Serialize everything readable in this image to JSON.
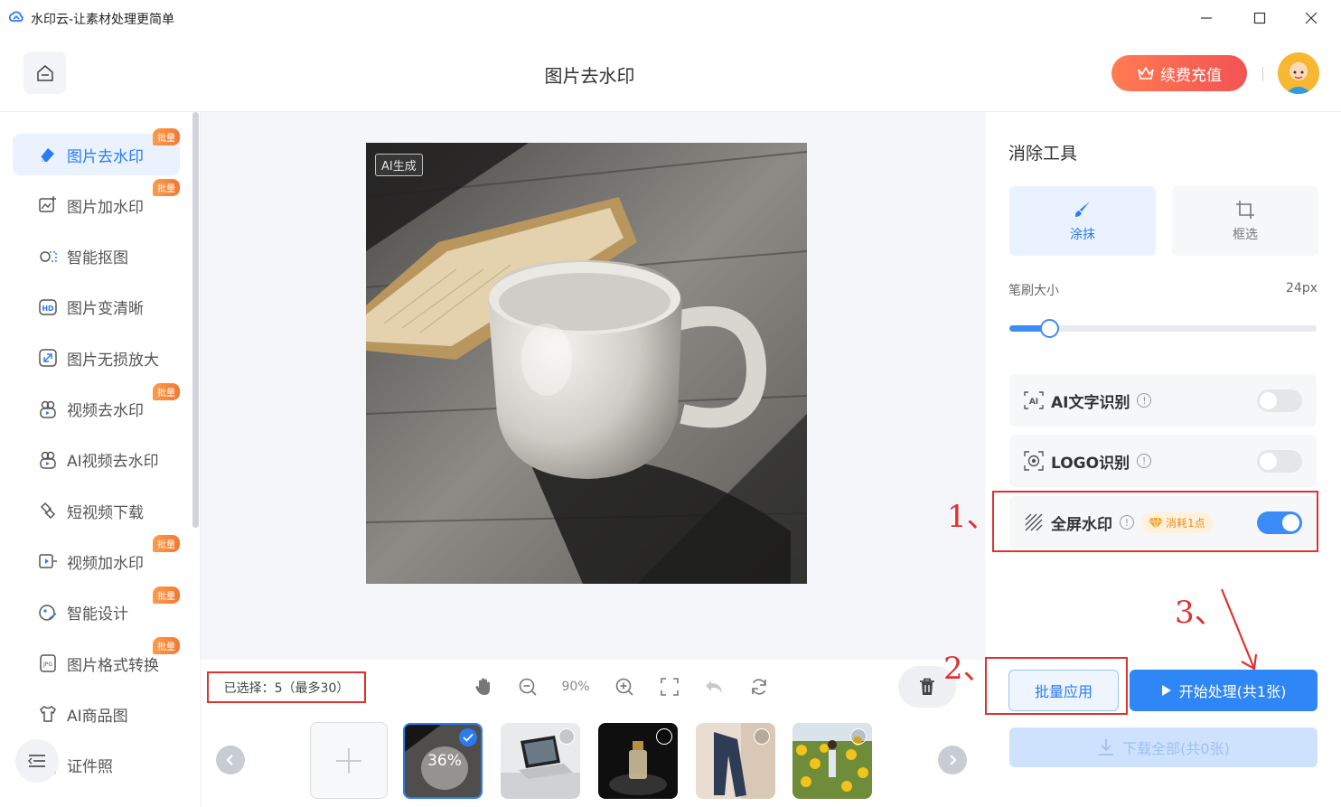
{
  "window": {
    "title": "水印云-让素材处理更简单"
  },
  "header": {
    "page_title": "图片去水印",
    "renew_label": "续费充值"
  },
  "sidebar": {
    "items": [
      {
        "label": "图片去水印",
        "badge": "批量",
        "icon": "eraser-icon",
        "active": true
      },
      {
        "label": "图片加水印",
        "badge": "批量",
        "icon": "image-add-icon"
      },
      {
        "label": "智能抠图",
        "badge": "",
        "icon": "cutout-icon"
      },
      {
        "label": "图片变清晰",
        "badge": "",
        "icon": "hd-icon"
      },
      {
        "label": "图片无损放大",
        "badge": "",
        "icon": "enlarge-icon"
      },
      {
        "label": "视频去水印",
        "badge": "批量",
        "icon": "video-eraser-icon"
      },
      {
        "label": "AI视频去水印",
        "badge": "",
        "icon": "ai-video-eraser-icon"
      },
      {
        "label": "短视频下载",
        "badge": "",
        "icon": "link-download-icon"
      },
      {
        "label": "视频加水印",
        "badge": "批量",
        "icon": "video-add-icon"
      },
      {
        "label": "智能设计",
        "badge": "批量",
        "icon": "design-icon"
      },
      {
        "label": "图片格式转换",
        "badge": "批量",
        "icon": "jpg-file-icon"
      },
      {
        "label": "AI商品图",
        "badge": "",
        "icon": "tshirt-icon"
      },
      {
        "label": "证件照",
        "badge": "",
        "icon": "id-photo-icon"
      }
    ]
  },
  "canvas": {
    "ai_badge": "AI生成"
  },
  "toolbar": {
    "selected_text": "已选择：5（最多30）",
    "zoom": "90%"
  },
  "thumbnails": {
    "progress_label": "36%"
  },
  "panel": {
    "title": "消除工具",
    "modes": [
      {
        "label": "涂抹",
        "active": true
      },
      {
        "label": "框选",
        "active": false
      }
    ],
    "brush_label": "笔刷大小",
    "brush_value": "24px",
    "brush_level": 0.13,
    "options": [
      {
        "label": "AI文字识别",
        "on": false
      },
      {
        "label": "LOGO识别",
        "on": false
      },
      {
        "label": "全屏水印",
        "on": true,
        "cost": "消耗1点"
      }
    ],
    "batch_label": "批量应用",
    "start_label": "开始处理(共1张)",
    "download_label": "下载全部(共0张)"
  },
  "annotations": {
    "mark_1": "1、",
    "mark_2": "2、",
    "mark_3": "3、"
  },
  "colors": {
    "accent": "#2f86f6",
    "highlight": "#e03131",
    "renew": "#f25353"
  }
}
